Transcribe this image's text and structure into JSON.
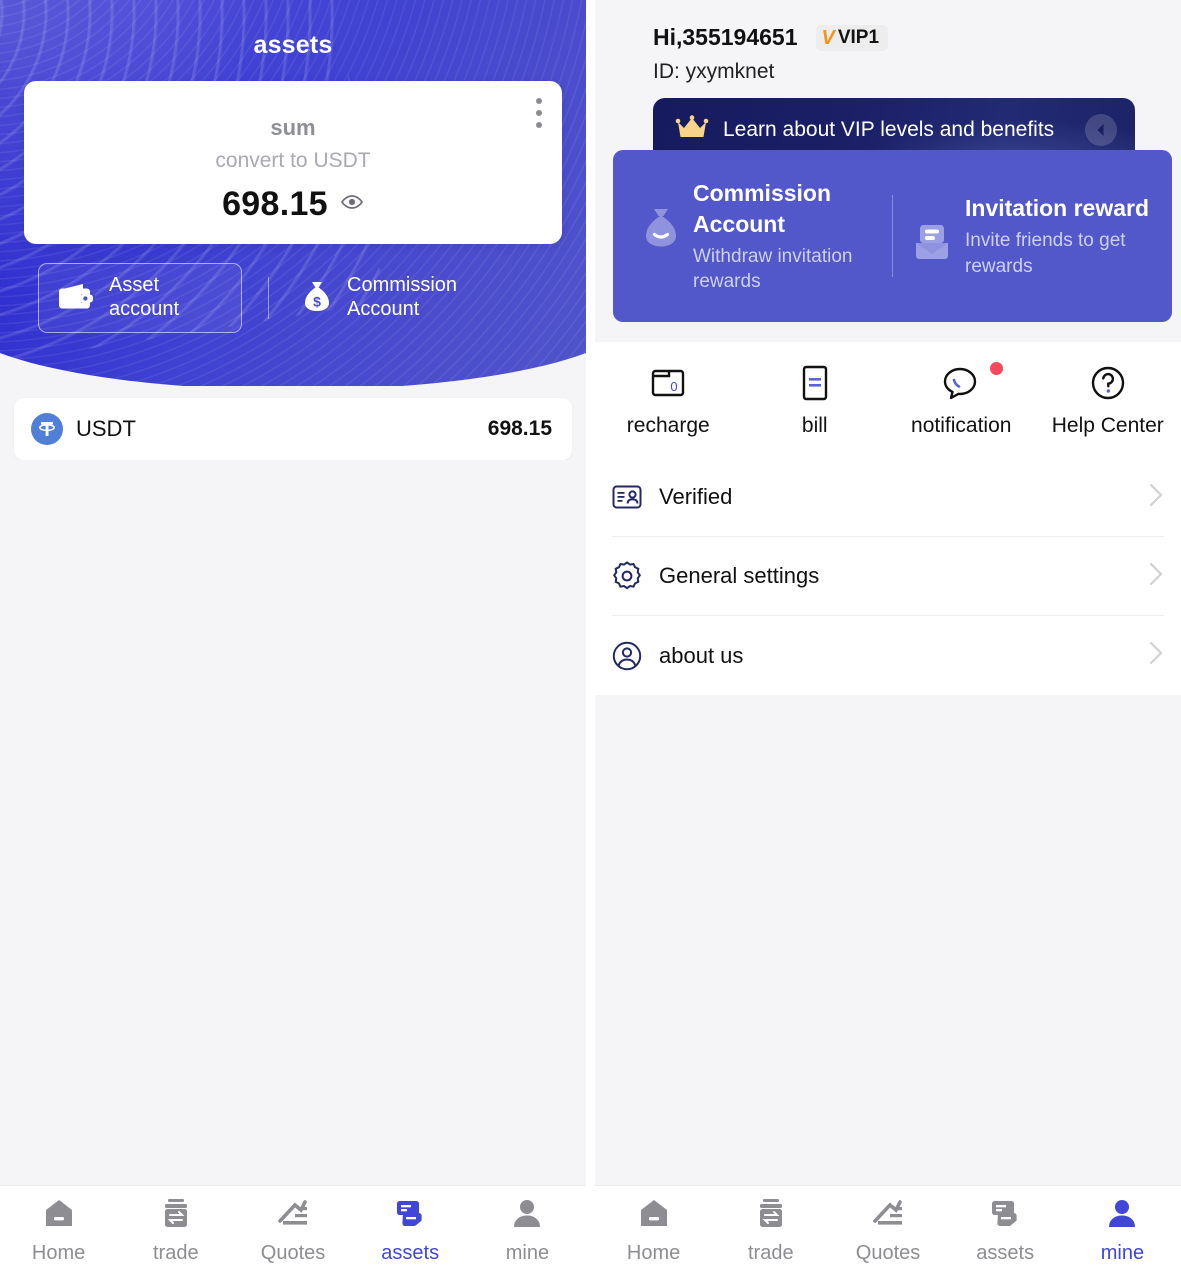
{
  "colors": {
    "brand_blue": "#4146d6",
    "hero_gradient_from": "#2423c8",
    "hero_gradient_to": "#5156c9",
    "promo_card": "#5257c9",
    "vip_banner": "#161a5e",
    "vip_gold": "#f39415",
    "notification_dot": "#f8485e",
    "page_bg": "#f5f5f7",
    "muted_text": "#8e8e96"
  },
  "left_panel": {
    "title": "assets",
    "sum_card": {
      "label": "sum",
      "sublabel": "convert to USDT",
      "amount": "698.15",
      "eye_icon": "eye-icon",
      "menu_icon": "kebab-menu-icon"
    },
    "account_tabs": [
      {
        "label": "Asset\naccount",
        "icon": "wallet-icon",
        "selected": true
      },
      {
        "label": "Commission\nAccount",
        "icon": "money-bag-icon",
        "selected": false
      }
    ],
    "coins": [
      {
        "icon": "usdt-coin-icon",
        "name": "USDT",
        "value": "698.15"
      }
    ],
    "tabbar": [
      {
        "label": "Home",
        "icon": "home-icon",
        "active": false
      },
      {
        "label": "trade",
        "icon": "trade-icon",
        "active": false
      },
      {
        "label": "Quotes",
        "icon": "quotes-icon",
        "active": false
      },
      {
        "label": "assets",
        "icon": "assets-icon",
        "active": true
      },
      {
        "label": "mine",
        "icon": "person-icon",
        "active": false
      }
    ]
  },
  "right_panel": {
    "greeting": "Hi,355194651",
    "vip_badge": {
      "mark": "V",
      "level": "VIP1"
    },
    "id_line": "ID: yxymknet",
    "vip_banner": {
      "text": "Learn about VIP levels and benefits",
      "crown_icon": "crown-icon",
      "arrow_icon": "arrow-left-circle-icon"
    },
    "promos": [
      {
        "title": "Commission Account",
        "subtitle": "Withdraw invitation rewards",
        "icon": "money-bag-icon"
      },
      {
        "title": "Invitation reward",
        "subtitle": "Invite friends to get rewards",
        "icon": "envelope-icon"
      }
    ],
    "quick_actions": [
      {
        "label": "recharge",
        "icon": "recharge-icon",
        "badge": false
      },
      {
        "label": "bill",
        "icon": "bill-icon",
        "badge": false
      },
      {
        "label": "notification",
        "icon": "notification-icon",
        "badge": true
      },
      {
        "label": "Help Center",
        "icon": "help-circle-icon",
        "badge": false
      }
    ],
    "menu": [
      {
        "label": "Verified",
        "icon": "id-card-icon"
      },
      {
        "label": "General settings",
        "icon": "gear-icon"
      },
      {
        "label": "about us",
        "icon": "user-circle-icon"
      }
    ],
    "tabbar": [
      {
        "label": "Home",
        "icon": "home-icon",
        "active": false
      },
      {
        "label": "trade",
        "icon": "trade-icon",
        "active": false
      },
      {
        "label": "Quotes",
        "icon": "quotes-icon",
        "active": false
      },
      {
        "label": "assets",
        "icon": "assets-icon",
        "active": false
      },
      {
        "label": "mine",
        "icon": "person-icon",
        "active": true
      }
    ]
  }
}
